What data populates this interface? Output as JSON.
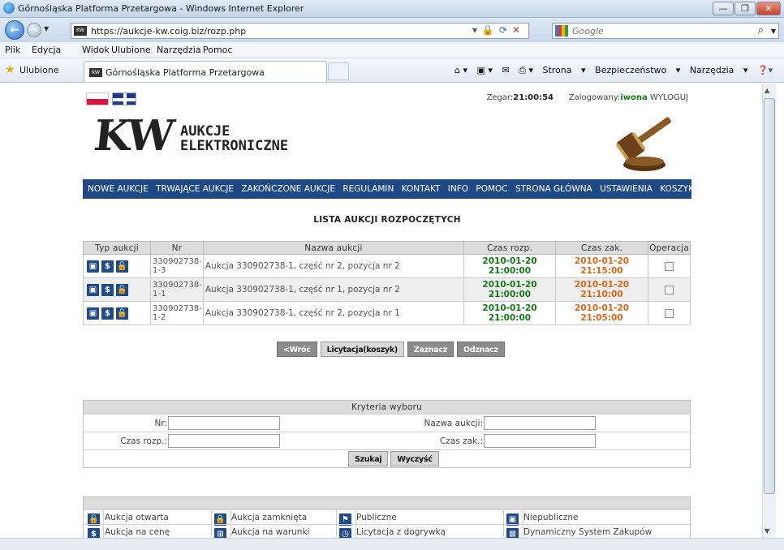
{
  "window": {
    "title": "Górnośląska Platforma Przetargowa - Windows Internet Explorer",
    "buttons": [
      "—",
      "❐",
      "✕"
    ]
  },
  "browser": {
    "url": "https://aukcje-kw.coig.biz/rozp.php",
    "search_placeholder": "Google",
    "menu": [
      "Plik",
      "Edycja",
      "Widok",
      "Ulubione",
      "Narzędzia",
      "Pomoc"
    ],
    "favorites_label": "Ulubione",
    "tab_title": "Górnośląska Platforma Przetargowa",
    "command_bar": [
      "Strona",
      "Bezpieczeństwo",
      "Narzędzia"
    ]
  },
  "header": {
    "logo_kw": "KW",
    "logo_line1": "AUKCJE",
    "logo_line2": "ELEKTRONICZNE",
    "clock_label": "Zegar:",
    "clock_time": "21:00:54",
    "logged_label": "Zalogowany:",
    "logged_user": "iwona",
    "logout": "WYLOGUJ"
  },
  "nav": [
    "NOWE AUKCJE",
    "TRWAJĄCE AUKCJE",
    "ZAKOŃCZONE AUKCJE",
    "REGULAMIN",
    "KONTAKT",
    "INFO",
    "POMOC",
    "STRONA GŁÓWNA",
    "USTAWIENIA",
    "KOSZYK"
  ],
  "list": {
    "title": "LISTA AUKCJI ROZPOCZĘTYCH",
    "columns": [
      "Typ aukcji",
      "Nr",
      "Nazwa aukcji",
      "Czas rozp.",
      "Czas zak.",
      "Operacja"
    ],
    "rows": [
      {
        "nr": "330902738-1-3",
        "name": "Aukcja 330902738-1, część nr 2, pozycja nr 2",
        "start": "2010-01-20 21:00:00",
        "end": "2010-01-20 21:15:00"
      },
      {
        "nr": "330902738-1-1",
        "name": "Aukcja 330902738-1, część nr 1, pozycja nr 2",
        "start": "2010-01-20 21:00:00",
        "end": "2010-01-20 21:10:00"
      },
      {
        "nr": "330902738-1-2",
        "name": "Aukcja 330902738-1, część nr 2, pozycja nr 1",
        "start": "2010-01-20 21:00:00",
        "end": "2010-01-20 21:05:00"
      }
    ]
  },
  "actions": {
    "back": "<Wróć",
    "bid": "Licytacja(koszyk)",
    "select": "Zaznacz",
    "deselect": "Odznacz"
  },
  "criteria": {
    "title": "Kryteria wyboru",
    "nr_label": "Nr:",
    "name_label": "Nazwa aukcji:",
    "start_label": "Czas rozp.:",
    "end_label": "Czas zak.:",
    "search_btn": "Szukaj",
    "clear_btn": "Wyczyść"
  },
  "legend": {
    "row1": [
      "Aukcja otwarta",
      "Aukcja zamknięta",
      "Publiczne",
      "Niepubliczne"
    ],
    "row2": [
      "Aukcja na cenę",
      "Aukcja na warunki",
      "Licytacja z dogrywką",
      "Dynamiczny System Zakupów"
    ]
  }
}
